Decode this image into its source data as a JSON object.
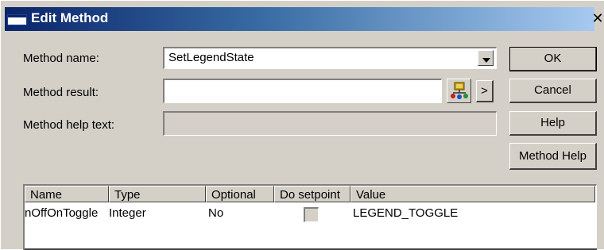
{
  "window": {
    "title": "Edit Method",
    "close_glyph": "✕"
  },
  "form": {
    "method_name_label": "Method name:",
    "method_name_value": "SetLegendState",
    "method_result_label": "Method result:",
    "method_result_value": "",
    "method_help_label": "Method help text:",
    "method_help_value": ""
  },
  "buttons": {
    "ok": "OK",
    "cancel": "Cancel",
    "help": "Help",
    "method_help": "Method Help",
    "more": ">"
  },
  "table": {
    "columns": [
      "Name",
      "Type",
      "Optional",
      "Do setpoint",
      "Value"
    ],
    "rows": [
      {
        "name": "nOffOnToggle",
        "type": "Integer",
        "optional": "No",
        "do_setpoint": false,
        "value": "LEGEND_TOGGLE"
      }
    ]
  },
  "icons": {
    "browse": "object-browser-icon",
    "dropdown": "chevron-down-icon",
    "window": "window-icon"
  }
}
